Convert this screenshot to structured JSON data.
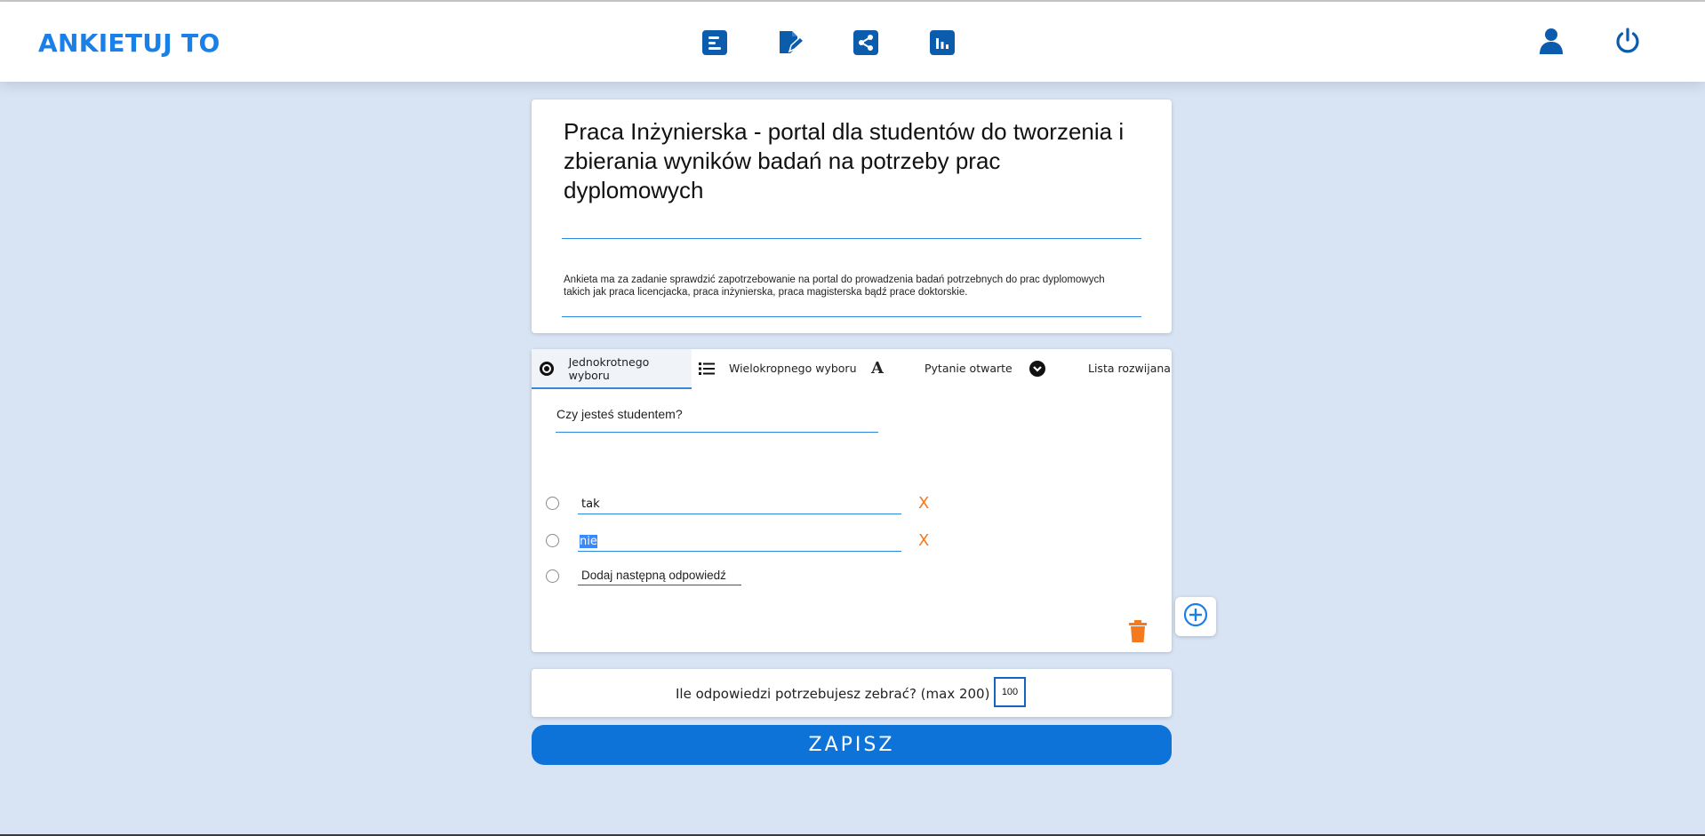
{
  "app": {
    "logo": "ANKIETUJ TO"
  },
  "nav": {
    "items": [
      {
        "icon": "form-list-icon"
      },
      {
        "icon": "edit-document-icon"
      },
      {
        "icon": "share-icon"
      },
      {
        "icon": "results-chart-icon"
      }
    ],
    "right": [
      {
        "icon": "user-icon"
      },
      {
        "icon": "power-icon"
      }
    ]
  },
  "survey": {
    "title": "Praca Inżynierska - portal dla studentów do tworzenia i zbierania wyników badań na potrzeby prac dyplomowych",
    "description": "Ankieta ma za zadanie sprawdzić zapotrzebowanie na portal do prowadzenia badań potrzebnych do prac dyplomowych takich jak praca licencjacka, praca inżynierska, praca magisterska bądź prace doktorskie."
  },
  "question": {
    "tabs": [
      {
        "label": "Jednokrotnego wyboru",
        "icon": "radio-icon",
        "active": true
      },
      {
        "label": "Wielokropnego wyboru",
        "icon": "list-icon",
        "active": false
      },
      {
        "label": "Pytanie otwarte",
        "icon": "text-icon",
        "active": false
      },
      {
        "label": "Lista rozwijana",
        "icon": "dropdown-icon",
        "active": false
      }
    ],
    "text": "Czy jesteś studentem?",
    "answers": [
      {
        "value": "tak"
      },
      {
        "value": "nie",
        "selected": true
      }
    ],
    "add_answer_label": "Dodaj następną odpowiedź",
    "remove_symbol": "X"
  },
  "responses": {
    "label": "Ile odpowiedzi potrzebujesz zebrać? (max 200)",
    "value": "100"
  },
  "save_label": "ZAPISZ",
  "colors": {
    "accent": "#1a7fe6",
    "nav_icon": "#0b5cad",
    "danger": "#f47a20",
    "save": "#0d73d9",
    "background": "#d8e4f3"
  }
}
